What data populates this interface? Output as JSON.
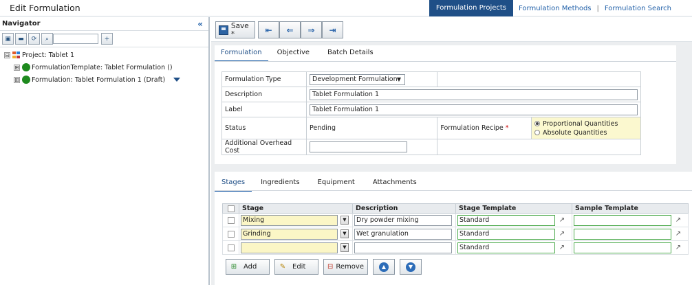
{
  "header": {
    "title": "Edit Formulation",
    "nav": {
      "active": "Formulation Projects",
      "links": [
        "Formulation Methods",
        "Formulation Search"
      ],
      "separator": "|"
    }
  },
  "navigator": {
    "title": "Navigator",
    "collapse": "«",
    "search_value": "",
    "tree": [
      {
        "label": "Project: Tablet 1",
        "toggle": "⊟"
      },
      {
        "label": "FormulationTemplate: Tablet Formulation ()",
        "toggle": "⊞"
      },
      {
        "label": "Formulation: Tablet Formulation 1 (Draft)",
        "toggle": "⊞"
      }
    ]
  },
  "toolbar": {
    "save_label": "Save *"
  },
  "formulation_tabs": [
    "Formulation",
    "Objective",
    "Batch Details"
  ],
  "form": {
    "formulation_type_label": "Formulation Type",
    "formulation_type_value": "Development Formulation",
    "description_label": "Description",
    "description_value": "Tablet Formulation 1",
    "label_label": "Label",
    "label_value": "Tablet Formulation 1",
    "status_label": "Status",
    "status_value": "Pending",
    "recipe_label": "Formulation Recipe",
    "recipe_required": "*",
    "recipe_options": [
      "Proportional Quantities",
      "Absolute Quantities"
    ],
    "recipe_selected": "Proportional Quantities",
    "overhead_label": "Additional Overhead Cost",
    "overhead_value": ""
  },
  "stage_tabs": [
    "Stages",
    "Ingredients",
    "Equipment",
    "Attachments"
  ],
  "grid": {
    "columns": [
      "Stage",
      "Description",
      "Stage Template",
      "Sample Template"
    ],
    "rows": [
      {
        "stage": "Mixing",
        "description": "Dry powder mixing",
        "stage_template": "Standard",
        "sample_template": ""
      },
      {
        "stage": "Grinding",
        "description": "Wet granulation",
        "stage_template": "Standard",
        "sample_template": ""
      },
      {
        "stage": "",
        "description": "",
        "stage_template": "Standard",
        "sample_template": ""
      }
    ]
  },
  "grid_buttons": {
    "add": "Add",
    "edit": "Edit",
    "remove": "Remove"
  }
}
